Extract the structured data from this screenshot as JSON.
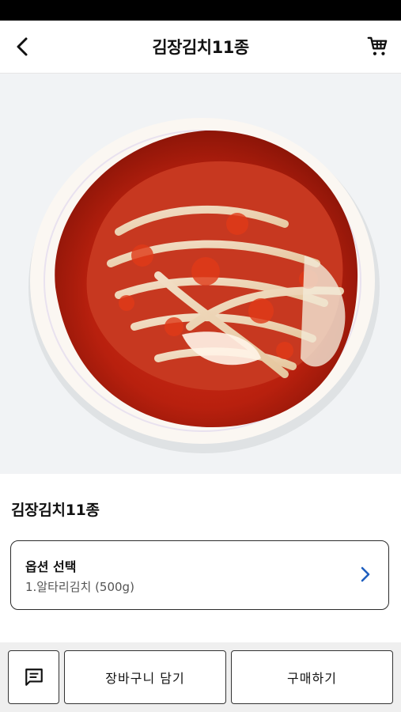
{
  "header": {
    "title": "김장김치11종",
    "back_icon": "chevron-left-icon",
    "cart_icon": "cart-icon"
  },
  "carousel": {
    "image": "kimchi-plate-photo",
    "total_slides": 3,
    "active_index": 0
  },
  "product": {
    "name": "김장김치11종"
  },
  "option": {
    "label": "옵션 선택",
    "value": "1.알타리김치 (500g)",
    "chevron_color": "#1f5fbf"
  },
  "actions": {
    "chat_icon": "chat-icon",
    "add_to_cart": "장바구니 담기",
    "buy": "구매하기"
  }
}
